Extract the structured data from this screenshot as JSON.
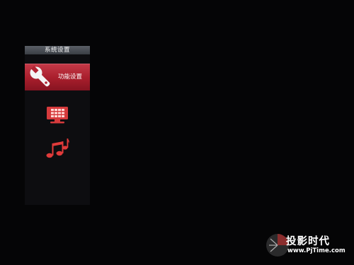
{
  "menu": {
    "title": "系统设置",
    "items": [
      {
        "id": "function",
        "label": "功能设置",
        "icon": "wrench-icon",
        "selected": true
      },
      {
        "id": "display",
        "label": "",
        "icon": "display-grid-icon",
        "selected": false
      },
      {
        "id": "audio",
        "label": "",
        "icon": "music-note-icon",
        "selected": false
      }
    ]
  },
  "watermark": {
    "title": "投影时代",
    "url": "www.PjTime.com"
  },
  "colors": {
    "background": "#050506",
    "panel": "#0d0d10",
    "header": "#4a4e55",
    "selected": "#b32433",
    "icon_red": "#e03a3a"
  }
}
